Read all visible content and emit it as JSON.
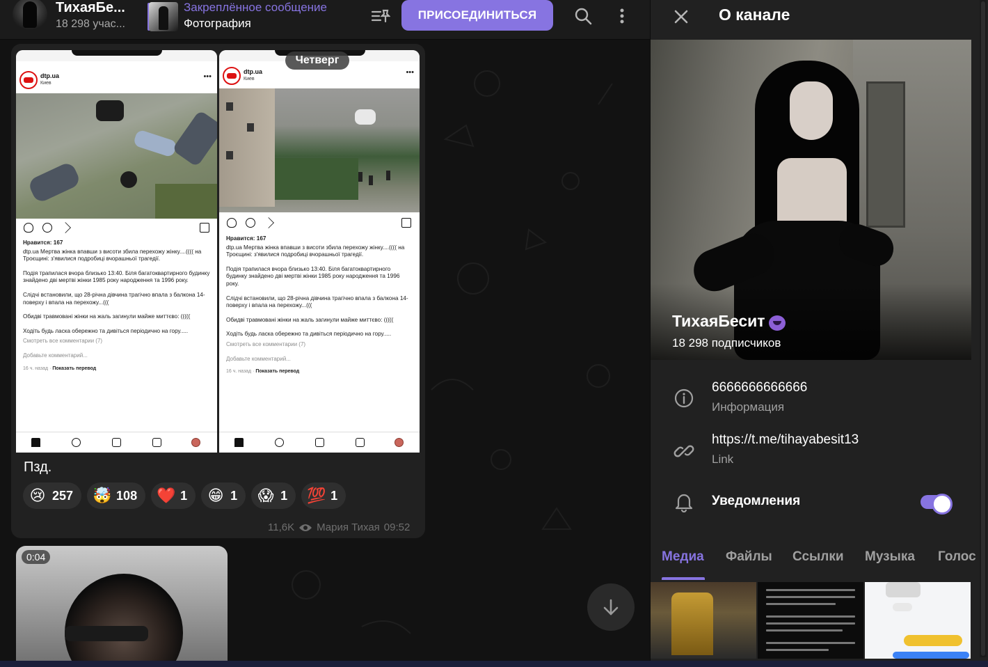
{
  "header": {
    "title": "ТихаяБе...",
    "subtitle": "18 298 учас...",
    "pinned_title": "Закреплённое сообщение",
    "pinned_text": "Фотография",
    "join_label": "ПРИСОЕДИНИТЬСЯ"
  },
  "post": {
    "date_pill": "Четверг",
    "screenshot": {
      "account": "dtp.ua",
      "location": "Киев",
      "likes": "Нравится: 167",
      "paragraphs": [
        "dtp.ua Мертва жінка впавши з висоти збила перехожу жінку....(((( на Троєщині: з'явилися подробиці вчорашньої трагедії.",
        "Подія трапилася вчора близько 13:40. Біля багатоквартирного будинку знайдено дві мертві жінки 1985 року народження та 1996 року.",
        "Слідчі встановили, що 28-річна дівчина трагічно впала з балкона 14-поверху і впала на перехожу...(((",
        "Обидві травмовані жінки на жаль загинули майже миттєво: (((((",
        "Ходіть будь ласка обережно та дивіться періодично на гору....."
      ],
      "comments": "Смотреть все комментарии (7)",
      "add_comment": "Добавьте комментарий...",
      "time": "16 ч. назад",
      "translate": "Показать перевод"
    },
    "caption": "Пзд.",
    "reactions": [
      {
        "emoji": "😢",
        "count": "257"
      },
      {
        "emoji": "🤯",
        "count": "108"
      },
      {
        "emoji": "❤️",
        "count": "1"
      },
      {
        "emoji": "😁",
        "count": "1"
      },
      {
        "emoji": "😱",
        "count": "1"
      },
      {
        "emoji": "💯",
        "count": "1"
      }
    ],
    "views": "11,6K",
    "author": "Мария Тихая",
    "time": "09:52"
  },
  "video": {
    "duration": "0:04"
  },
  "panel": {
    "title": "О канале",
    "channel_name": "ТихаяБесит",
    "subscribers": "18 298 подписчиков",
    "info_value": "6666666666666",
    "info_label": "Информация",
    "link_value": "https://t.me/tihayabesit13",
    "link_label": "Link",
    "notifications_label": "Уведомления",
    "notifications_on": true,
    "tabs": [
      "Медиа",
      "Файлы",
      "Ссылки",
      "Музыка",
      "Голос"
    ]
  },
  "colors": {
    "accent": "#8774e1",
    "bg": "#121212",
    "panel": "#212121"
  },
  "icons": [
    "pin-list-icon",
    "search-icon",
    "more-icon",
    "close-icon",
    "info-icon",
    "link-icon",
    "bell-icon",
    "arrow-down-icon",
    "eye-icon",
    "devil-emoji-icon"
  ]
}
